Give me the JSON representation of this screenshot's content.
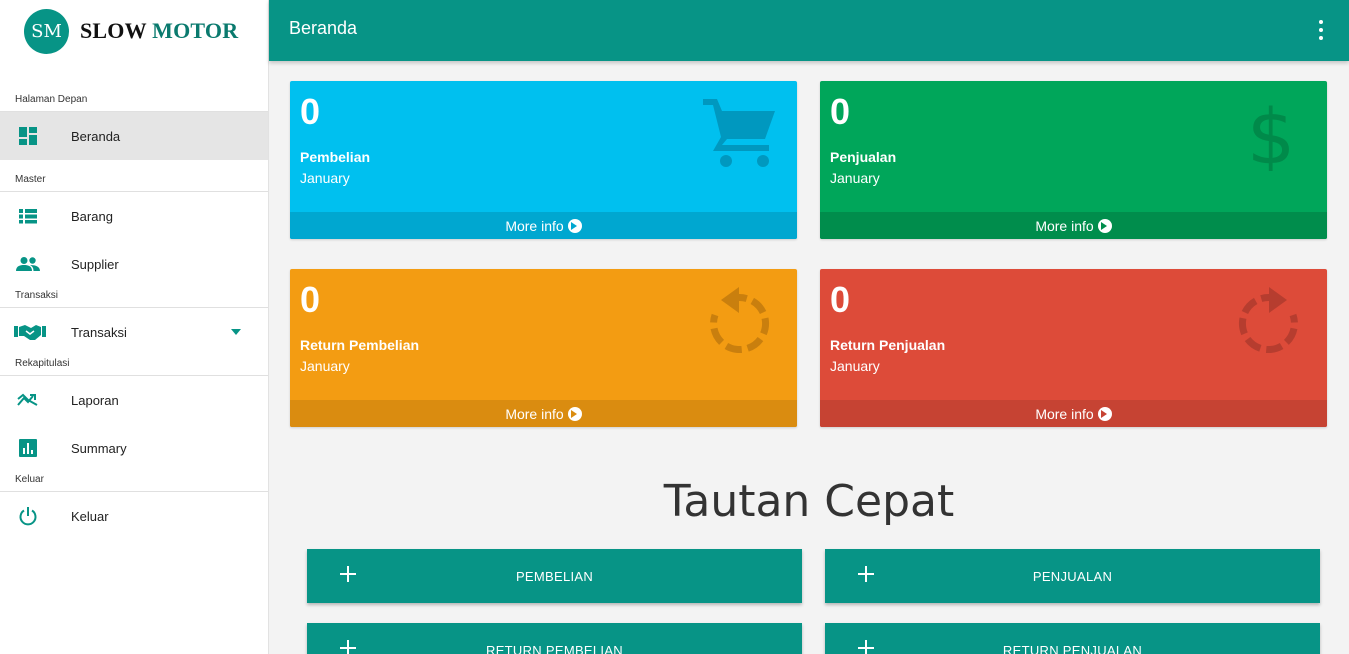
{
  "brand": {
    "logo": "SM",
    "name_part1": "SLOW",
    "name_part2": "MOTOR"
  },
  "header": {
    "title": "Beranda",
    "menu_icon": "more-vert-icon"
  },
  "sidebar": {
    "sections": [
      {
        "label": "Halaman Depan",
        "items": [
          {
            "label": "Beranda",
            "icon": "dashboard-icon",
            "active": true
          }
        ]
      },
      {
        "label": "Master",
        "items": [
          {
            "label": "Barang",
            "icon": "list-icon"
          },
          {
            "label": "Supplier",
            "icon": "people-icon"
          }
        ]
      },
      {
        "label": "Transaksi",
        "items": [
          {
            "label": "Transaksi",
            "icon": "handshake-icon",
            "has_caret": true
          }
        ]
      },
      {
        "label": "Rekapitulasi",
        "items": [
          {
            "label": "Laporan",
            "icon": "trending-icon"
          },
          {
            "label": "Summary",
            "icon": "bar-chart-icon"
          }
        ]
      },
      {
        "label": "Keluar",
        "items": [
          {
            "label": "Keluar",
            "icon": "power-icon"
          }
        ]
      }
    ]
  },
  "info_boxes": [
    {
      "count": "0",
      "label": "Pembelian",
      "period": "January",
      "footer": "More info",
      "icon": "shopping-cart-icon",
      "color": "#00c0ef"
    },
    {
      "count": "0",
      "label": "Penjualan",
      "period": "January",
      "footer": "More info",
      "icon": "dollar-icon",
      "color": "#00a65a"
    },
    {
      "count": "0",
      "label": "Return Pembelian",
      "period": "January",
      "footer": "More info",
      "icon": "rotate-left-icon",
      "color": "#f39c12"
    },
    {
      "count": "0",
      "label": "Return Penjualan",
      "period": "January",
      "footer": "More info",
      "icon": "rotate-right-icon",
      "color": "#dd4b39"
    }
  ],
  "quick_links": {
    "title": "Tautan Cepat",
    "buttons": [
      {
        "label": "PEMBELIAN"
      },
      {
        "label": "PENJUALAN"
      },
      {
        "label": "RETURN PEMBELIAN"
      },
      {
        "label": "RETURN PENJUALAN"
      }
    ]
  },
  "colors": {
    "primary": "#079486",
    "aqua": "#00c0ef",
    "green": "#00a65a",
    "orange": "#f39c12",
    "red": "#dd4b39"
  }
}
